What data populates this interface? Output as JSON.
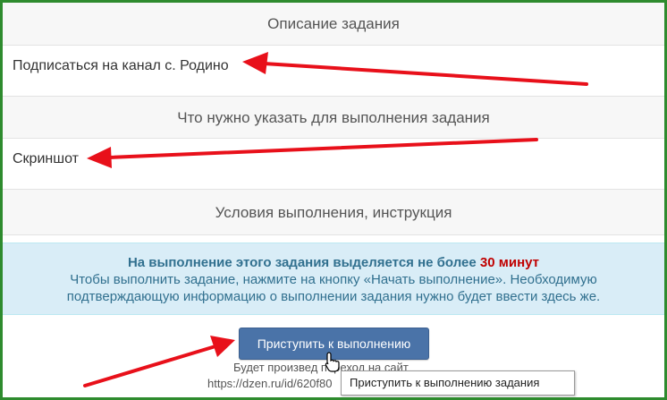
{
  "sections": {
    "description_header": "Описание задания",
    "description_body": "Подписаться на канал с. Родино",
    "required_header": "Что нужно указать для выполнения задания",
    "required_body": "Скриншот",
    "conditions_header": "Условия выполнения, инструкция"
  },
  "info": {
    "line1_prefix": "На выполнение этого задания выделяется не более ",
    "line1_time": "30 минут",
    "line2": "Чтобы выполнить задание, нажмите на кнопку «Начать выполнение». Необходимую",
    "line3": "подтверждающую информацию о выполнении задания нужно будет ввести здесь же."
  },
  "action": {
    "start_button": "Приступить к выполнению",
    "note_line1": "Будет произвед    переход на сайт",
    "note_line2": "https://dzen.ru/id/620f80"
  },
  "tooltip": {
    "text": "Приступить к выполнению задания"
  },
  "colors": {
    "arrow": "#e8101a",
    "frame": "#2e8b2e",
    "button": "#4a73a8",
    "info_bg": "#d9edf7"
  },
  "icons": {
    "cursor": "hand-pointer-icon"
  }
}
